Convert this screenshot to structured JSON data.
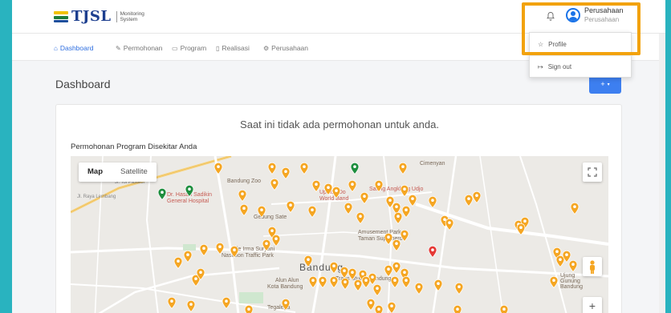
{
  "brand": {
    "name": "TJSL",
    "subtitle": "Monitoring System"
  },
  "user": {
    "name": "Perusahaan",
    "role": "Perusahaan"
  },
  "dropdown": {
    "profile": "Profile",
    "signout": "Sign out"
  },
  "nav": [
    {
      "label": "Dashboard",
      "icon": "home-icon",
      "active": true
    },
    {
      "label": "Permohonan",
      "icon": "pencil-icon"
    },
    {
      "label": "Program",
      "icon": "folder-icon"
    },
    {
      "label": "Realisasi",
      "icon": "document-icon"
    },
    {
      "label": "Perusahaan",
      "icon": "gear-icon"
    }
  ],
  "page": {
    "title": "Dashboard",
    "add_button": "+"
  },
  "card": {
    "notice": "Saat ini tidak ada permohonan untuk anda.",
    "section_title": "Permohonan Program Disekitar Anda"
  },
  "map": {
    "type_map": "Map",
    "type_satellite": "Satellite",
    "zoom_in": "+",
    "labels": {
      "city": "Bandung",
      "zoo": "Bandung Zoo",
      "hospital_1": "Dr. Hasan Sadikin",
      "hospital_2": "General Hospital",
      "gedung_sate": "Gedung Sate",
      "saung": "Saung Angklung Udjo",
      "amusement_1": "Amusement Park",
      "amusement_2": "Taman Superhero",
      "ade_1": "Ade Irma Suryani",
      "ade_2": "Nasution Traffic Park",
      "alun_1": "Alun Alun",
      "alun_2": "Kota Bandung",
      "trans": "Trans Studio Bandung",
      "cimenyan": "Cimenyan",
      "tegalega": "Tegalega",
      "upside_1": "Upside Do",
      "upside_2": "World Band",
      "gunung": "Ujung Gunung Bandung",
      "jl_tol": "Jl. Tol Pasteur",
      "jl_raya": "Jl. Raya Lembang"
    },
    "pin_colors": {
      "orange": "#f5a623",
      "green": "#1e8e3e",
      "red": "#e53935"
    }
  }
}
